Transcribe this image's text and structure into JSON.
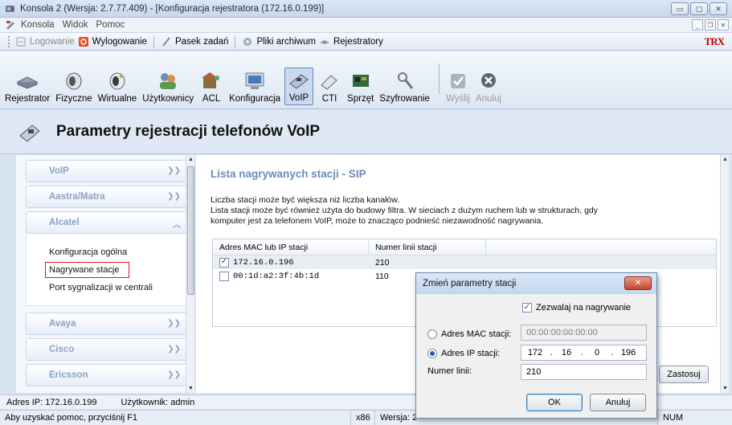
{
  "window": {
    "title": "Konsola 2 (Wersja: 2.7.77.409) - [Konfiguracja rejestratora (172.16.0.199)]"
  },
  "menu": {
    "items": [
      "Konsola",
      "Widok",
      "Pomoc"
    ]
  },
  "quickbar": {
    "login": "Logowanie",
    "logout": "Wylogowanie",
    "taskbar": "Pasek zadań",
    "archives": "Pliki archiwum",
    "recorders": "Rejestratory",
    "brand": "TRX"
  },
  "toolbar": {
    "buttons": [
      {
        "label": "Rejestrator",
        "icon": "recorder-icon"
      },
      {
        "label": "Fizyczne",
        "icon": "physical-channels-icon"
      },
      {
        "label": "Wirtualne",
        "icon": "virtual-channels-icon"
      },
      {
        "label": "Użytkownicy",
        "icon": "users-icon"
      },
      {
        "label": "ACL",
        "icon": "acl-icon"
      },
      {
        "label": "Konfiguracja",
        "icon": "configuration-icon"
      },
      {
        "label": "VoIP",
        "icon": "voip-icon"
      },
      {
        "label": "CTI",
        "icon": "cti-icon"
      },
      {
        "label": "Sprzęt",
        "icon": "hardware-icon"
      },
      {
        "label": "Szyfrowanie",
        "icon": "encryption-icon"
      },
      {
        "label": "Wyślij",
        "icon": "send-icon"
      },
      {
        "label": "Anuluj",
        "icon": "cancel-icon"
      }
    ]
  },
  "header": {
    "title": "Parametry rejestracji telefonów VoIP"
  },
  "sidebar": {
    "groups": [
      "VoIP",
      "Aastra/Matra",
      "Alcatel",
      "Avaya",
      "Cisco",
      "Ericsson"
    ],
    "alcatel_items": [
      "Konfiguracja ogólna",
      "Nagrywane stacje",
      "Port sygnalizacji w centrali"
    ]
  },
  "content": {
    "title": "Lista nagrywanych stacji - SIP",
    "desc1": "Liczba stacji może być większa niż liczba kanałów.",
    "desc2": "Lista stacji może być również użyta do budowy filtra. W sieciach z dużym ruchem lub w strukturach, gdy",
    "desc3": "komputer jest za telefonem VoIP, może to znacząco podnieść niezawodność nagrywania.",
    "columns": [
      "Adres MAC lub IP stacji",
      "Numer linii stacji"
    ],
    "rows": [
      {
        "address": "172.16.0.196",
        "line": "210",
        "checked": true
      },
      {
        "address": "00:1d:a2:3f:4b:1d",
        "line": "110",
        "checked": false
      }
    ],
    "apply_button": "Zastosuj"
  },
  "dialog": {
    "title": "Zmień parametry stacji",
    "allow_recording": "Zezwalaj na nagrywanie",
    "mac_label": "Adres MAC stacji:",
    "mac_value": "00:00:00:00:00:00",
    "ip_label": "Adres IP stacji:",
    "ip_octets": [
      "172",
      "16",
      "0",
      "196"
    ],
    "line_label": "Numer linii:",
    "line_value": "210",
    "ok": "OK",
    "cancel": "Anuluj"
  },
  "status": {
    "ip": "Adres IP: 172.16.0.199",
    "user": "Użytkownik: admin",
    "help": "Aby uzyskać pomoc, przyciśnij F1",
    "arch": "x86",
    "version": "Wersja: 2",
    "num": "NUM"
  }
}
